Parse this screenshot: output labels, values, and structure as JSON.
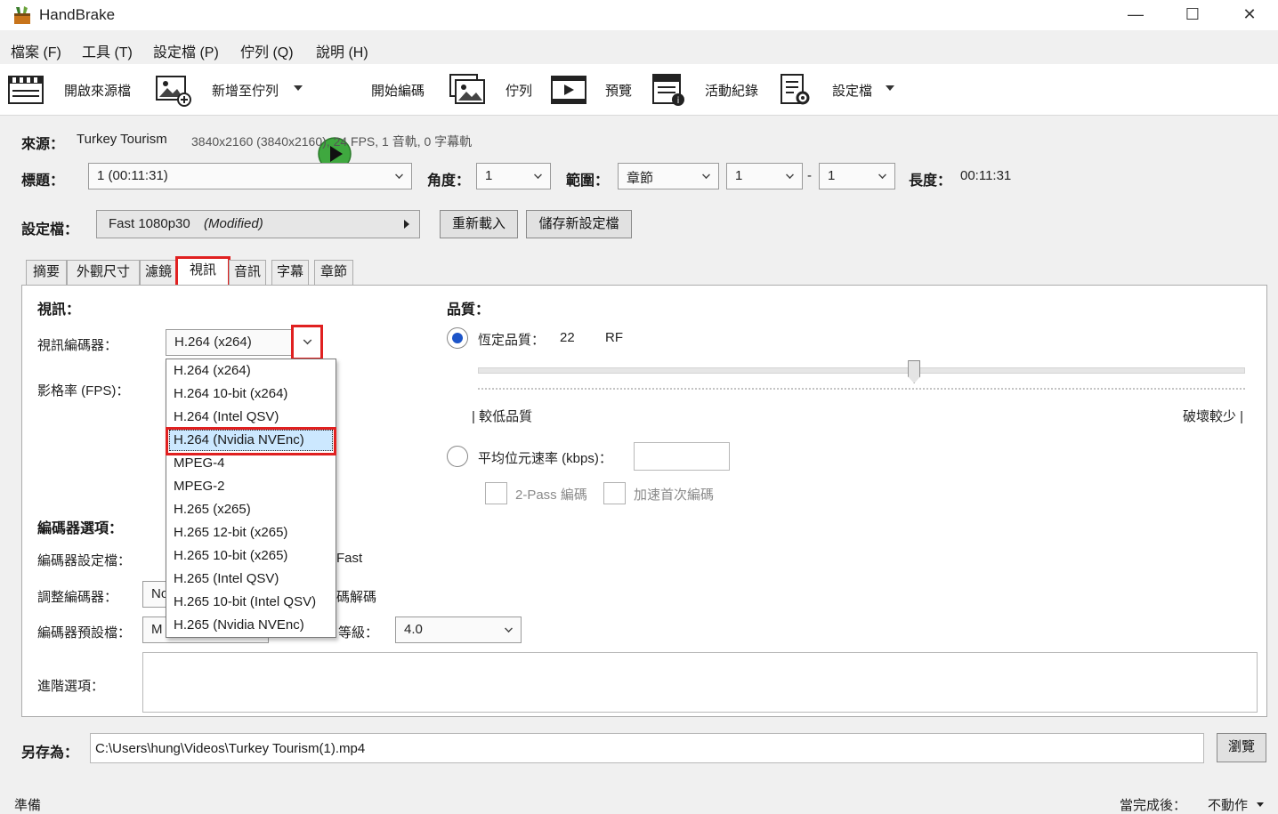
{
  "window": {
    "title": "HandBrake",
    "minimize": "—",
    "maximize": "☐",
    "close": "✕"
  },
  "menu": [
    "檔案 (F)",
    "工具 (T)",
    "設定檔 (P)",
    "佇列 (Q)",
    "說明 (H)"
  ],
  "toolbar": {
    "open_source": "開啟來源檔",
    "add_to_queue": "新增至佇列",
    "start_encode": "開始編碼",
    "queue": "佇列",
    "preview": "預覽",
    "activity_log": "活動紀錄",
    "presets": "設定檔"
  },
  "source": {
    "label": "來源：",
    "name": "Turkey Tourism",
    "info": "3840x2160 (3840x2160), 24 FPS, 1 音軌, 0 字幕軌"
  },
  "title_row": {
    "title_label": "標題：",
    "title_value": "1  (00:11:31)",
    "angle_label": "角度：",
    "angle_value": "1",
    "range_label": "範圍：",
    "range_type": "章節",
    "range_start": "1",
    "range_sep": "-",
    "range_end": "1",
    "duration_label": "長度：",
    "duration_value": "00:11:31"
  },
  "preset_row": {
    "label": "設定檔：",
    "value": "Fast 1080p30",
    "modified": "(Modified)",
    "reload_button": "重新載入",
    "save_new_button": "儲存新設定檔"
  },
  "tabs": [
    "摘要",
    "外觀尺寸",
    "濾鏡",
    "視訊",
    "音訊",
    "字幕",
    "章節"
  ],
  "video": {
    "section_label": "視訊：",
    "encoder_label": "視訊編碼器：",
    "encoder_value": "H.264 (x264)",
    "fps_label": "影格率 (FPS)：",
    "encoder_options_label": "編碼器選項：",
    "encoder_preset_label": "編碼器設定檔：",
    "encoder_preset_right": "Fast",
    "tune_label": "調整編碼器：",
    "tune_value": "No",
    "tune_right": "碼解碼",
    "profile_label": "編碼器預設檔：",
    "profile_value": "M",
    "level_label": "等級：",
    "level_value": "4.0",
    "advanced_label": "進階選項："
  },
  "encoder_dropdown": [
    "H.264 (x264)",
    "H.264 10-bit (x264)",
    "H.264 (Intel QSV)",
    "H.264 (Nvidia NVEnc)",
    "MPEG-4",
    "MPEG-2",
    "H.265 (x265)",
    "H.265 12-bit (x265)",
    "H.265 10-bit (x265)",
    "H.265 (Intel QSV)",
    "H.265 10-bit (Intel QSV)",
    "H.265 (Nvidia NVEnc)"
  ],
  "encoder_dropdown_highlighted": "H.264 (Nvidia NVEnc)",
  "quality": {
    "section_label": "品質：",
    "constant_quality_label": "恆定品質：",
    "rf_value": "22",
    "rf_unit": "RF",
    "low_quality_label": "| 較低品質",
    "high_quality_label": "破壞較少 |",
    "avg_bitrate_label": "平均位元速率 (kbps)：",
    "two_pass_label": "2-Pass 編碼",
    "turbo_label": "加速首次編碼"
  },
  "save_as": {
    "label": "另存為：",
    "path": "C:\\Users\\hung\\Videos\\Turkey Tourism(1).mp4",
    "browse_button": "瀏覽"
  },
  "status": {
    "left": "準備",
    "when_done_label": "當完成後：",
    "when_done_value": "不動作"
  }
}
